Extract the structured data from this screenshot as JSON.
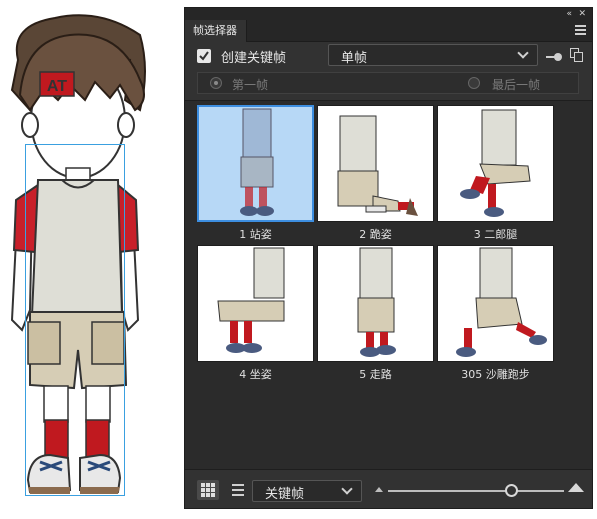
{
  "canvas": {
    "character_badge": "AT"
  },
  "panel": {
    "tab_title": "帧选择器",
    "collapse_glyph": "«",
    "close_glyph": "✕",
    "create_keyframe_label": "创建关键帧",
    "create_keyframe_checked": true,
    "mode_select_value": "单帧",
    "first_frame_label": "第一帧",
    "last_frame_label": "最后一帧",
    "frames": [
      {
        "label": "1 站姿",
        "selected": true
      },
      {
        "label": "2 跪姿",
        "selected": false
      },
      {
        "label": "3 二郎腿",
        "selected": false
      },
      {
        "label": "4 坐姿",
        "selected": false
      },
      {
        "label": "5 走路",
        "selected": false
      },
      {
        "label": "305 沙雕跑步",
        "selected": false
      }
    ],
    "filter_select_value": "关键帧"
  },
  "colors": {
    "panel_bg": "#323232",
    "selection_fill": "#b7d8f6",
    "selection_border": "#3d8ee0",
    "shirt_sleeve": "#c8202a",
    "shirt_body": "#deded6",
    "shorts": "#d6cdb5",
    "socks": "#c0191f"
  },
  "icons": [
    "menu-icon",
    "checkbox-check-icon",
    "chevron-down-icon",
    "toggle-icon",
    "copy-icon",
    "grid-view-icon",
    "list-view-icon",
    "zoom-small-icon",
    "zoom-large-icon"
  ]
}
